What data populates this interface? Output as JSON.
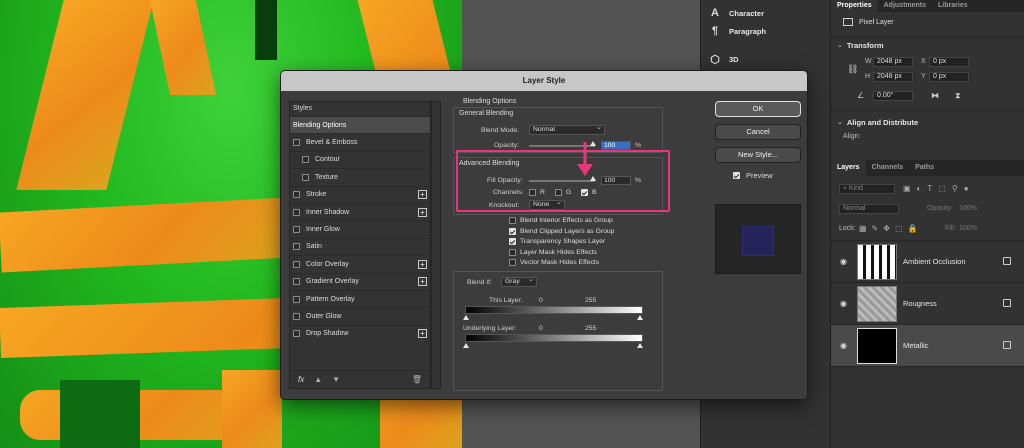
{
  "mid_dock": {
    "items": [
      {
        "icon": "character-icon",
        "label": "Character"
      },
      {
        "icon": "paragraph-icon",
        "label": "Paragraph"
      },
      {
        "icon": "3d-icon",
        "label": "3D"
      }
    ]
  },
  "right_top": {
    "tabs": [
      "Properties",
      "Adjustments",
      "Libraries"
    ],
    "pixel_layer": "Pixel Layer",
    "transform": {
      "title": "Transform",
      "w_label": "W",
      "w_value": "2048 px",
      "x_label": "X",
      "x_value": "0 px",
      "h_label": "H",
      "h_value": "2048 px",
      "y_label": "Y",
      "y_value": "0 px",
      "angle": "0.00°"
    },
    "align": {
      "title": "Align and Distribute",
      "align_label": "Align:"
    }
  },
  "layers_panel": {
    "tabs": [
      "Layers",
      "Channels",
      "Paths"
    ],
    "kind": "Kind",
    "blend": "Normal",
    "opacity_label": "Opacity:",
    "opacity_value": "100%",
    "lock_label": "Lock:",
    "fill_label": "Fill:",
    "fill_value": "100%",
    "layers": [
      {
        "name": "Ambient Occlusion"
      },
      {
        "name": "Rougness"
      },
      {
        "name": "Metallic"
      }
    ]
  },
  "dialog": {
    "title": "Layer Style",
    "styles_header": "Styles",
    "styles": [
      {
        "label": "Blending Options",
        "checkbox": false,
        "plus": false,
        "active": true,
        "sub": false
      },
      {
        "label": "Bevel & Emboss",
        "checkbox": true,
        "plus": false,
        "active": false,
        "sub": false
      },
      {
        "label": "Contour",
        "checkbox": true,
        "plus": false,
        "active": false,
        "sub": true
      },
      {
        "label": "Texture",
        "checkbox": true,
        "plus": false,
        "active": false,
        "sub": true
      },
      {
        "label": "Stroke",
        "checkbox": true,
        "plus": true,
        "active": false,
        "sub": false
      },
      {
        "label": "Inner Shadow",
        "checkbox": true,
        "plus": true,
        "active": false,
        "sub": false
      },
      {
        "label": "Inner Glow",
        "checkbox": true,
        "plus": false,
        "active": false,
        "sub": false
      },
      {
        "label": "Satin",
        "checkbox": true,
        "plus": false,
        "active": false,
        "sub": false
      },
      {
        "label": "Color Overlay",
        "checkbox": true,
        "plus": true,
        "active": false,
        "sub": false
      },
      {
        "label": "Gradient Overlay",
        "checkbox": true,
        "plus": true,
        "active": false,
        "sub": false
      },
      {
        "label": "Pattern Overlay",
        "checkbox": true,
        "plus": false,
        "active": false,
        "sub": false
      },
      {
        "label": "Outer Glow",
        "checkbox": true,
        "plus": false,
        "active": false,
        "sub": false
      },
      {
        "label": "Drop Shadow",
        "checkbox": true,
        "plus": true,
        "active": false,
        "sub": false
      }
    ],
    "fx_label": "fx",
    "blending_options": "Blending Options",
    "general": {
      "title": "General Blending",
      "blend_mode_label": "Blend Mode:",
      "blend_mode": "Normal",
      "opacity_label": "Opacity:",
      "opacity_value": "100",
      "percent": "%"
    },
    "advanced": {
      "title": "Advanced Blending",
      "fill_label": "Fill Opacity:",
      "fill_value": "100",
      "percent": "%",
      "channels_label": "Channels:",
      "channels": [
        {
          "label": "R",
          "checked": false
        },
        {
          "label": "G",
          "checked": false
        },
        {
          "label": "B",
          "checked": true
        }
      ],
      "knockout_label": "Knockout:",
      "knockout": "None"
    },
    "options": [
      {
        "label": "Blend Interior Effects as Group",
        "checked": false
      },
      {
        "label": "Blend Clipped Layers as Group",
        "checked": true
      },
      {
        "label": "Transparency Shapes Layer",
        "checked": true
      },
      {
        "label": "Layer Mask Hides Effects",
        "checked": false
      },
      {
        "label": "Vector Mask Hides Effects",
        "checked": false
      }
    ],
    "blend_if": {
      "label": "Blend If:",
      "channel": "Gray",
      "this_layer": "This Layer:",
      "underlying": "Underlying Layer:",
      "min": "0",
      "max": "255"
    },
    "buttons": {
      "ok": "OK",
      "cancel": "Cancel",
      "new_style": "New Style...",
      "preview": "Preview"
    },
    "preview_checked": true
  },
  "colors": {
    "highlight": "#e8357c",
    "preview_swatch": "#24245a"
  }
}
